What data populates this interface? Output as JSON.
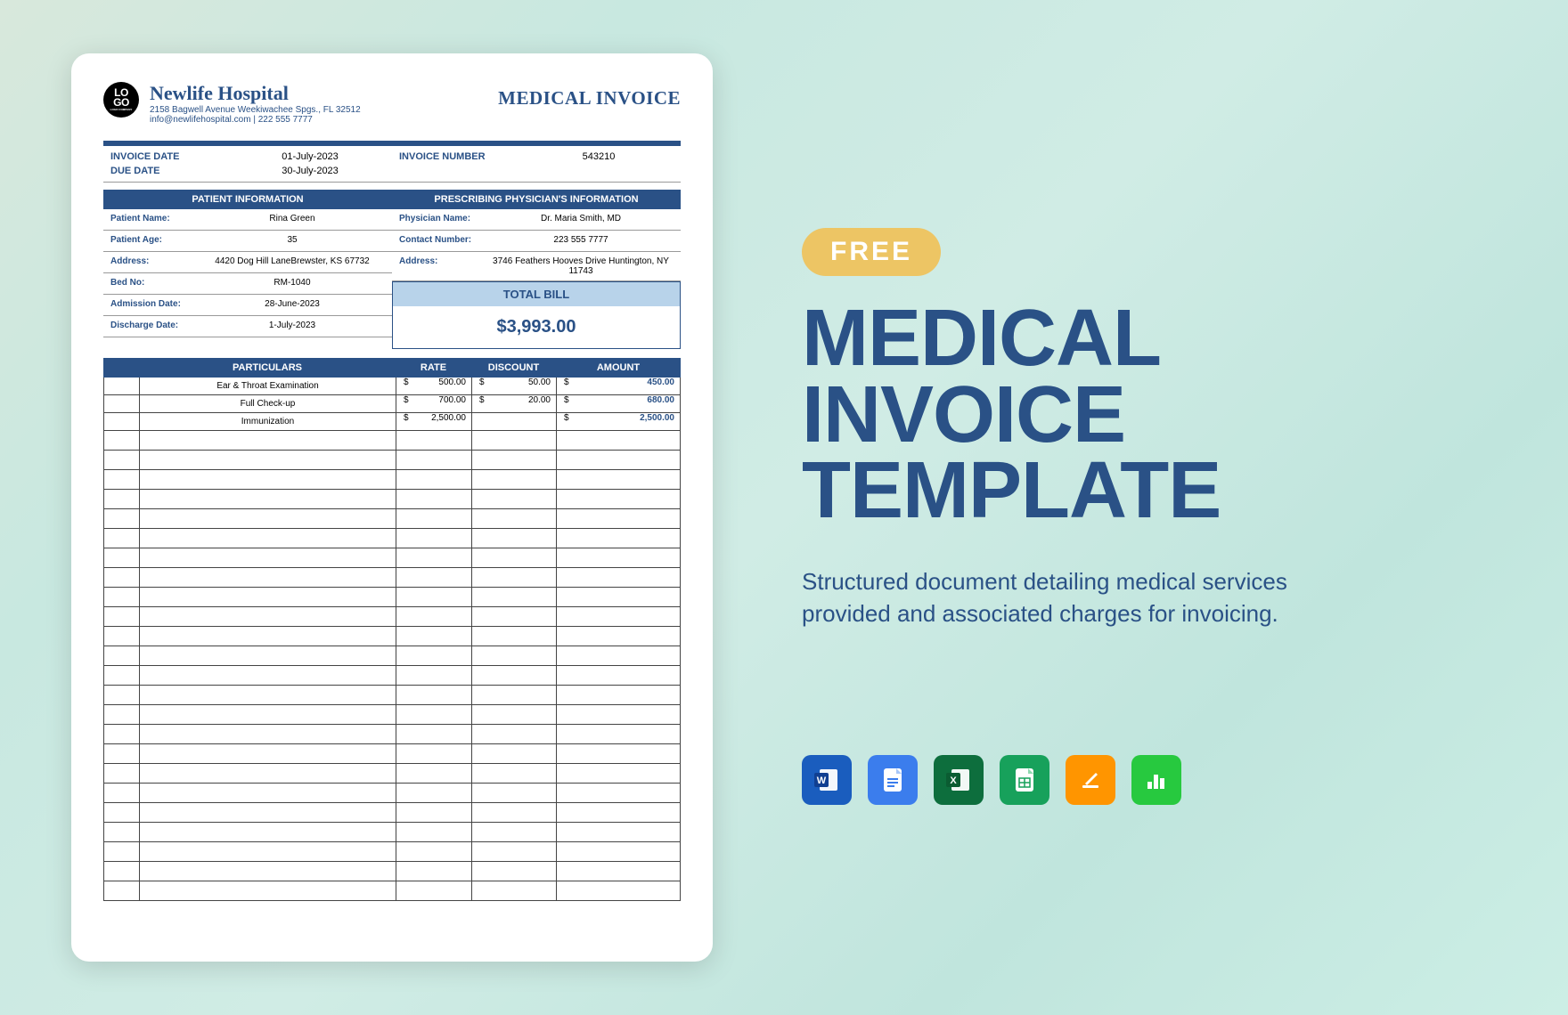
{
  "document": {
    "logo": {
      "top": "LO",
      "bot": "GO",
      "sub": "LOGO COMPANY"
    },
    "hospital_name": "Newlife Hospital",
    "hospital_addr": "2158 Bagwell Avenue Weekiwachee Spgs., FL 32512",
    "hospital_contact": "info@newlifehospital.com | 222 555 7777",
    "title": "MEDICAL INVOICE",
    "labels": {
      "invoice_date": "INVOICE DATE",
      "due_date": "DUE DATE",
      "invoice_number": "INVOICE NUMBER",
      "patient_section": "PATIENT INFORMATION",
      "physician_section": "PRESCRIBING PHYSICIAN'S INFORMATION",
      "patient_name": "Patient Name:",
      "patient_age": "Patient Age:",
      "address": "Address:",
      "bed_no": "Bed No:",
      "admission": "Admission Date:",
      "discharge": "Discharge Date:",
      "physician_name": "Physician Name:",
      "contact_number": "Contact Number:",
      "total_bill": "TOTAL BILL",
      "col_particulars": "PARTICULARS",
      "col_rate": "RATE",
      "col_discount": "DISCOUNT",
      "col_amount": "AMOUNT"
    },
    "invoice_date": "01-July-2023",
    "due_date": "30-July-2023",
    "invoice_number": "543210",
    "patient": {
      "name": "Rina Green",
      "age": "35",
      "address": "4420 Dog Hill LaneBrewster, KS 67732",
      "bed": "RM-1040",
      "admission": "28-June-2023",
      "discharge": "1-July-2023"
    },
    "physician": {
      "name": "Dr. Maria Smith, MD",
      "contact": "223 555 7777",
      "address": "3746 Feathers Hooves Drive Huntington, NY 11743"
    },
    "total": "$3,993.00",
    "currency": "$",
    "lines": [
      {
        "desc": "Ear & Throat Examination",
        "rate": "500.00",
        "discount": "50.00",
        "amount": "450.00"
      },
      {
        "desc": "Full Check-up",
        "rate": "700.00",
        "discount": "20.00",
        "amount": "680.00"
      },
      {
        "desc": "Immunization",
        "rate": "2,500.00",
        "discount": "",
        "amount": "2,500.00"
      }
    ]
  },
  "marketing": {
    "badge": "FREE",
    "title_l1": "MEDICAL",
    "title_l2": "INVOICE",
    "title_l3": "TEMPLATE",
    "desc": "Structured document detailing medical services provided and associated charges for invoicing.",
    "apps": [
      "Word",
      "Google Docs",
      "Excel",
      "Google Sheets",
      "Pages",
      "Numbers"
    ]
  }
}
